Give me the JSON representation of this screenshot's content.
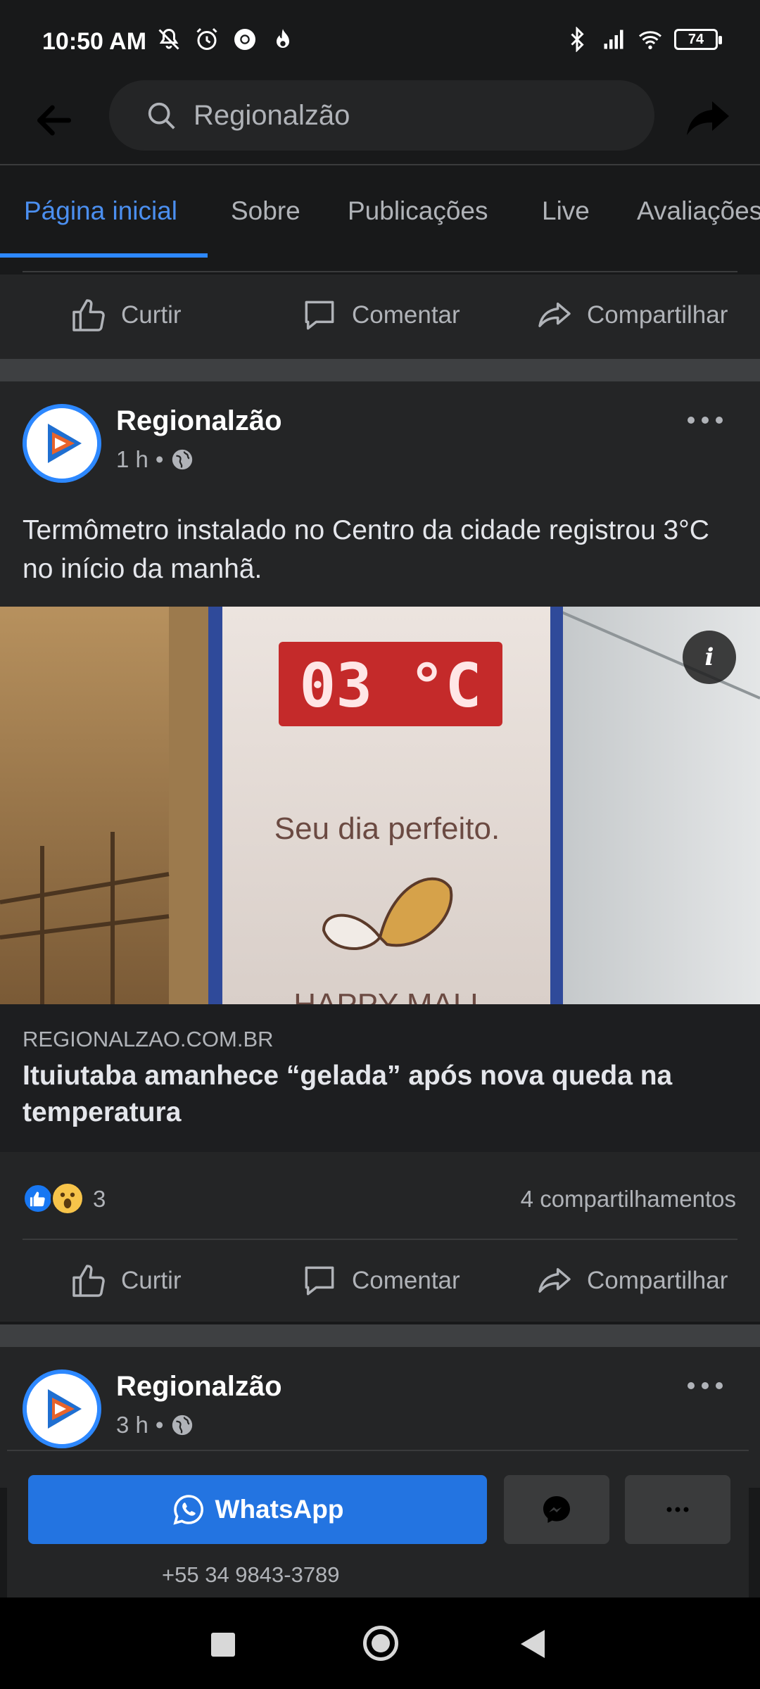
{
  "status_bar": {
    "time": "10:50 AM",
    "battery": "74",
    "icons_left": [
      "mute-icon",
      "alarm-icon",
      "chrome-icon",
      "fire-icon"
    ],
    "icons_right": [
      "bluetooth-icon",
      "signal-icon",
      "wifi-icon",
      "battery-icon"
    ]
  },
  "header": {
    "search_text": "Regionalzão"
  },
  "tabs": [
    {
      "label": "Página inicial",
      "active": true
    },
    {
      "label": "Sobre"
    },
    {
      "label": "Publicações"
    },
    {
      "label": "Live"
    },
    {
      "label": "Avaliações"
    }
  ],
  "actions": {
    "like": "Curtir",
    "comment": "Comentar",
    "share": "Compartilhar"
  },
  "post1": {
    "page_name": "Regionalzão",
    "time": "1 h",
    "text": "Termômetro instalado no Centro da cidade registrou 3°C no início da manhã.",
    "photo": {
      "display": "03 °C",
      "slogan": "Seu dia perfeito.",
      "sign_bottom": "HAPPY MALL"
    },
    "link": {
      "domain": "REGIONALZAO.COM.BR",
      "title": "Ituiutaba amanhece “gelada” após nova queda na temperatura"
    },
    "reactions_count": "3",
    "shares": "4 compartilhamentos"
  },
  "post2": {
    "page_name": "Regionalzão",
    "time": "3 h"
  },
  "cta": {
    "whatsapp_label": "WhatsApp",
    "phone": "+55 34 9843-3789"
  },
  "colors": {
    "accent": "#2d88ff",
    "whatsapp_button": "#2374e1",
    "background": "#18191a",
    "card": "#242526"
  }
}
